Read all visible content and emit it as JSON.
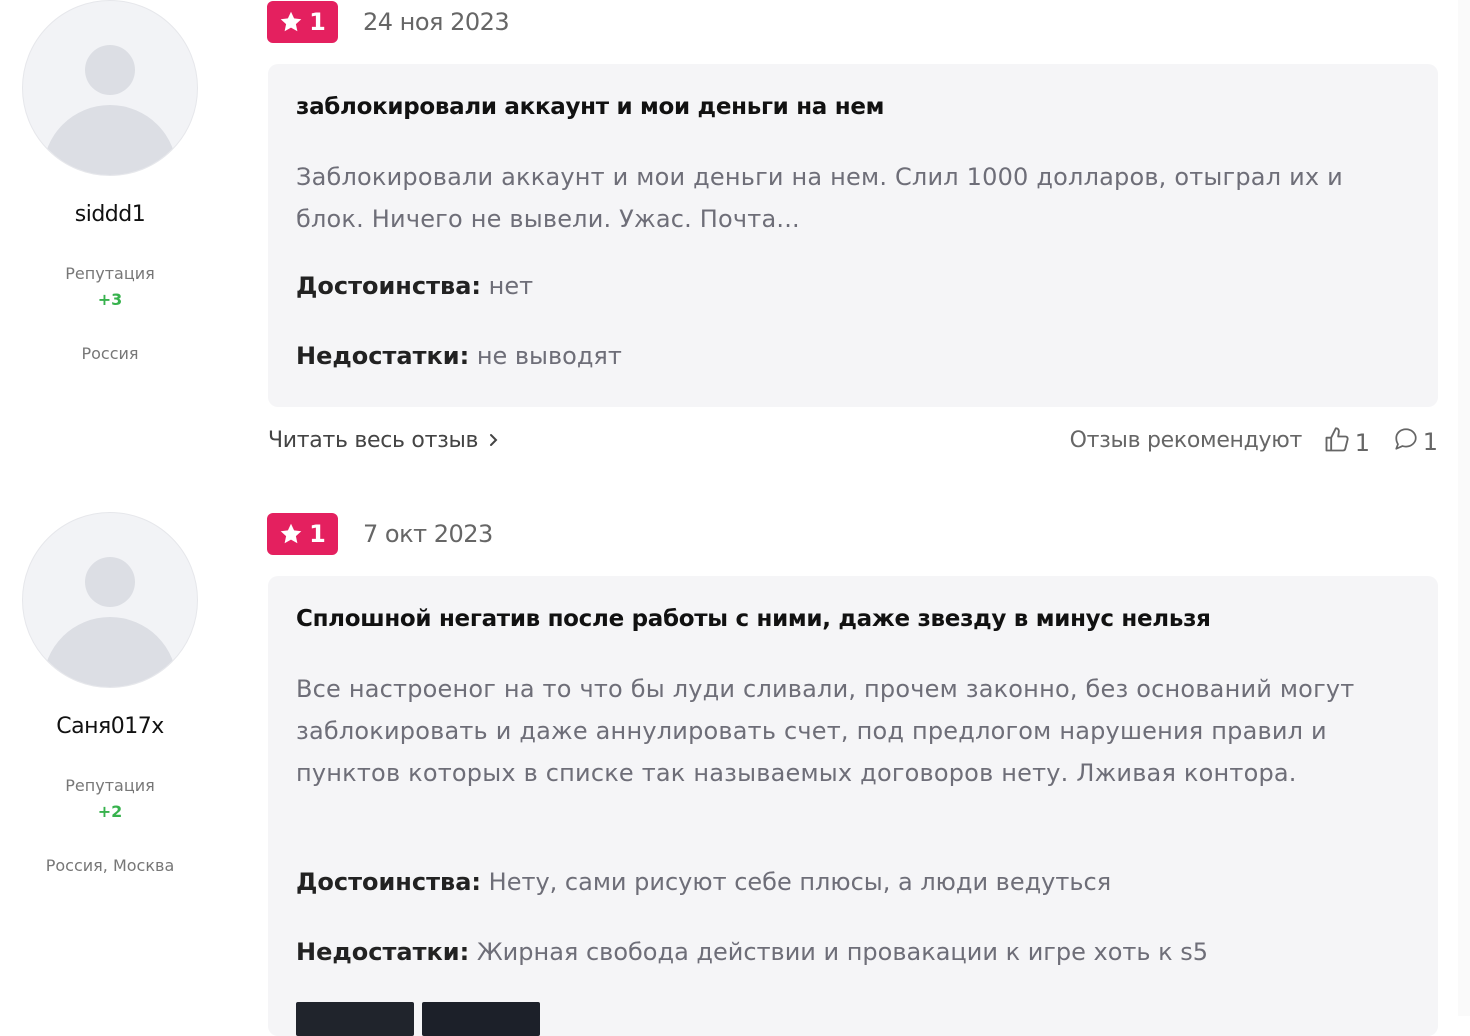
{
  "reviews": [
    {
      "author": "siddd1",
      "reputation_label": "Репутация",
      "reputation_value": "+3",
      "location": "Россия",
      "rating": "1",
      "date": "24 ноя 2023",
      "title": "заблокировали аккаунт и мои деньги на нем",
      "text": "Заблокировали аккаунт и мои деньги на нем. Слил 1000 долларов, отыграл их и блок. Ничего не вывели. Ужас. Почта...",
      "pros_label": "Достоинства:",
      "pros": "нет",
      "cons_label": "Недостатки:",
      "cons": "не выводят",
      "read_more": "Читать весь отзыв",
      "recommend_label": "Отзыв рекомендуют",
      "likes": "1",
      "comments": "1"
    },
    {
      "author": "Саня017x",
      "reputation_label": "Репутация",
      "reputation_value": "+2",
      "location": "Россия, Москва",
      "rating": "1",
      "date": "7 окт 2023",
      "title": "Сплошной негатив после работы с ними, даже звезду в минус нельзя",
      "text": "Все настроеног на то что бы луди сливали, прочем законно, без оснований могут заблокировать и даже аннулировать счет, под предлогом нарушения правил и пунктов которых в списке так называемых договоров нету. Лживая контора.",
      "pros_label": "Достоинства:",
      "pros": "Нету, сами рисуют себе плюсы, а люди ведуться",
      "cons_label": "Недостатки:",
      "cons": "Жирная свобода действии и провакации к игре хоть к s5"
    }
  ],
  "colors": {
    "rating_badge": "#e4205f",
    "reputation_positive": "#37b24d",
    "card_bg": "#f5f5f7"
  },
  "icons": {
    "rating": "star-icon",
    "read_more": "chevron-right-icon",
    "likes": "thumbs-up-icon",
    "comments": "comment-icon",
    "avatar": "user-placeholder-icon"
  }
}
